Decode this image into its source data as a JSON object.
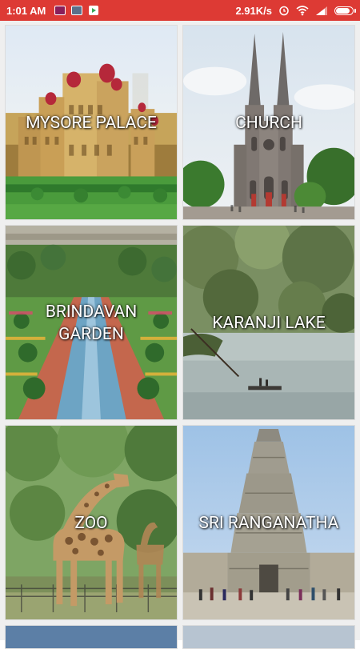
{
  "status_bar": {
    "time": "1:01 AM",
    "network_speed": "2.91K/s",
    "icons": [
      "message-icon",
      "gallery-icon",
      "play-store-icon",
      "alarm-icon",
      "wifi-icon",
      "signal-icon",
      "battery-icon"
    ],
    "battery_level": 0.9
  },
  "places": [
    {
      "title": "MYSORE PALACE"
    },
    {
      "title": "CHURCH"
    },
    {
      "title": "BRINDAVAN GARDEN"
    },
    {
      "title": "KARANJI LAKE"
    },
    {
      "title": "ZOO"
    },
    {
      "title": "SRI RANGANATHA"
    }
  ],
  "colors": {
    "status_bar": "#dd3a34",
    "label_text": "#ffffff",
    "background": "#efefef"
  }
}
